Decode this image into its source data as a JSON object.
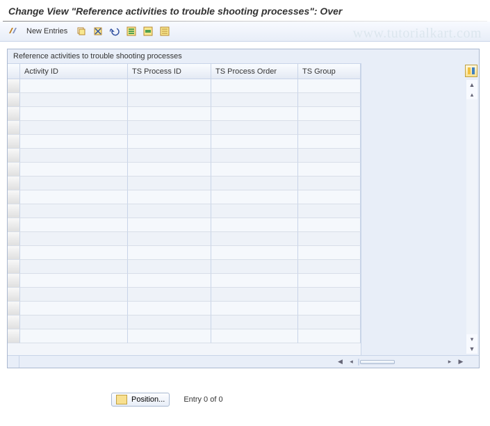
{
  "title": "Change View \"Reference activities to trouble shooting processes\": Over",
  "toolbar": {
    "new_entries": "New Entries"
  },
  "watermark": "www.tutorialkart.com",
  "table": {
    "title": "Reference activities to trouble shooting processes",
    "columns": {
      "activity_id": "Activity ID",
      "process_id": "TS Process ID",
      "process_order": "TS Process Order",
      "group": "TS Group"
    },
    "rows": [
      {
        "activity_id": "",
        "process_id": "",
        "process_order": "",
        "group": ""
      },
      {
        "activity_id": "",
        "process_id": "",
        "process_order": "",
        "group": ""
      },
      {
        "activity_id": "",
        "process_id": "",
        "process_order": "",
        "group": ""
      },
      {
        "activity_id": "",
        "process_id": "",
        "process_order": "",
        "group": ""
      },
      {
        "activity_id": "",
        "process_id": "",
        "process_order": "",
        "group": ""
      },
      {
        "activity_id": "",
        "process_id": "",
        "process_order": "",
        "group": ""
      },
      {
        "activity_id": "",
        "process_id": "",
        "process_order": "",
        "group": ""
      },
      {
        "activity_id": "",
        "process_id": "",
        "process_order": "",
        "group": ""
      },
      {
        "activity_id": "",
        "process_id": "",
        "process_order": "",
        "group": ""
      },
      {
        "activity_id": "",
        "process_id": "",
        "process_order": "",
        "group": ""
      },
      {
        "activity_id": "",
        "process_id": "",
        "process_order": "",
        "group": ""
      },
      {
        "activity_id": "",
        "process_id": "",
        "process_order": "",
        "group": ""
      },
      {
        "activity_id": "",
        "process_id": "",
        "process_order": "",
        "group": ""
      },
      {
        "activity_id": "",
        "process_id": "",
        "process_order": "",
        "group": ""
      },
      {
        "activity_id": "",
        "process_id": "",
        "process_order": "",
        "group": ""
      },
      {
        "activity_id": "",
        "process_id": "",
        "process_order": "",
        "group": ""
      },
      {
        "activity_id": "",
        "process_id": "",
        "process_order": "",
        "group": ""
      },
      {
        "activity_id": "",
        "process_id": "",
        "process_order": "",
        "group": ""
      },
      {
        "activity_id": "",
        "process_id": "",
        "process_order": "",
        "group": ""
      }
    ]
  },
  "footer": {
    "position_label": "Position...",
    "entry_status": "Entry 0 of 0"
  }
}
